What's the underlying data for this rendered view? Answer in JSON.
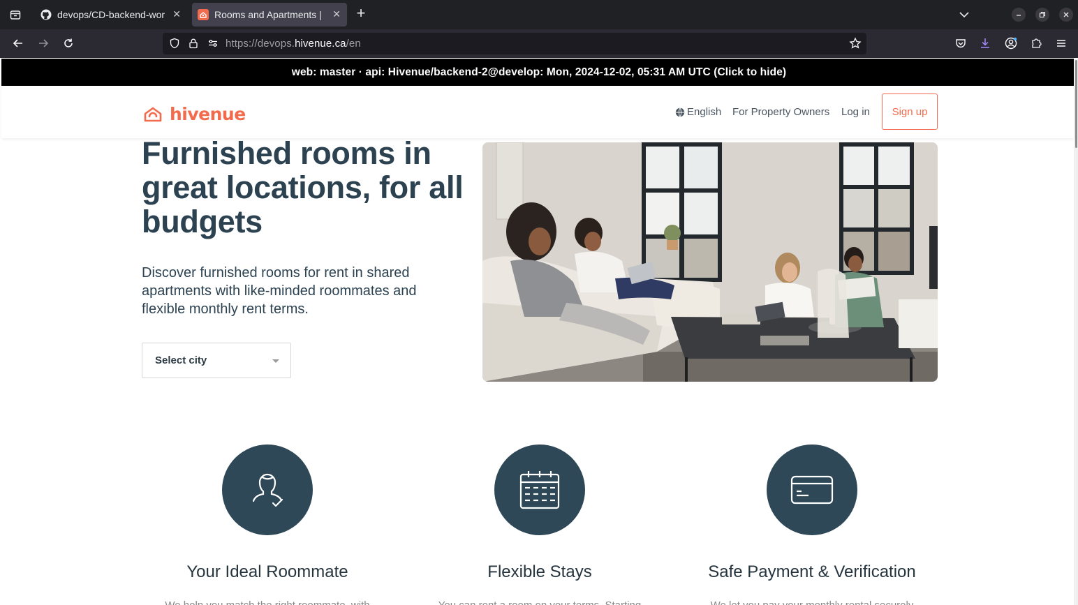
{
  "browser": {
    "tabs": [
      {
        "title": "devops/CD-backend-wor",
        "active": false
      },
      {
        "title": "Rooms and Apartments |",
        "active": true
      }
    ],
    "url": {
      "prefix": "https://devops.",
      "host": "hivenue.ca",
      "path": "/en"
    },
    "icons": [
      "tab-list-icon",
      "github-icon",
      "hivenue-favicon",
      "close-tab-icon",
      "new-tab-icon",
      "list-all-tabs-icon",
      "minimize-icon",
      "restore-icon",
      "close-window-icon",
      "back-icon",
      "forward-icon",
      "reload-icon",
      "tracking-protection-icon",
      "lock-icon",
      "permissions-icon",
      "bookmark-star-icon",
      "pocket-icon",
      "downloads-icon",
      "account-icon",
      "extensions-icon",
      "menu-icon"
    ]
  },
  "dev_banner": {
    "text": "web: master  ·  api: Hivenue/backend-2@develop: Mon, 2024-12-02, 05:31 AM UTC (Click to hide)"
  },
  "header": {
    "logo_text": "hivenue",
    "nav": {
      "language": "English",
      "owners": "For Property Owners",
      "login": "Log in",
      "signup": "Sign up"
    }
  },
  "hero": {
    "title": "Furnished rooms in great locations, for all budgets",
    "subtitle": "Discover furnished rooms for rent in shared apartments with like-minded roommates and flexible monthly rent terms.",
    "city_select_label": "Select city"
  },
  "features": [
    {
      "icon": "roommate-icon",
      "title": "Your Ideal Roommate",
      "text": "We help you match the right roommate, with"
    },
    {
      "icon": "calendar-icon",
      "title": "Flexible Stays",
      "text": "You can rent a room on your terms. Starting"
    },
    {
      "icon": "credit-card-icon",
      "title": "Safe Payment & Verification",
      "text": "We let you pay your monthly rental securely"
    }
  ],
  "colors": {
    "brand": "#f26b4d",
    "heading": "#2c4251",
    "feature_circle": "#2e4858",
    "banner_bg": "#000000"
  }
}
